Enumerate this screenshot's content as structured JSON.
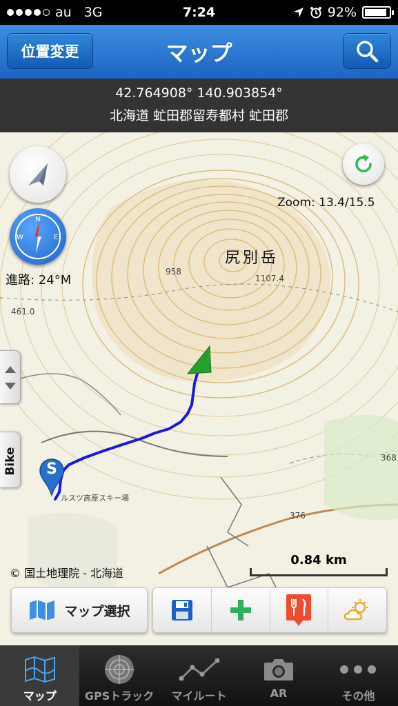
{
  "status": {
    "carrier": "au",
    "network": "3G",
    "time": "7:24",
    "battery": "92%",
    "battery_level": 0.92
  },
  "nav": {
    "left_button": "位置変更",
    "title": "マップ",
    "search_icon": "search-icon"
  },
  "info": {
    "coordinates": "42.764908° 140.903854°",
    "address": "北海道 虻田郡留寿都村 虻田郡"
  },
  "map": {
    "zoom_label": "Zoom: 13.4/15.5",
    "heading_label": "進路: 24°M",
    "side_tab_label": "Bike",
    "start_marker_label": "S",
    "attribution": "© 国土地理院 - 北海道",
    "scale_label": "0.84 km",
    "mountain_name": "尻別岳",
    "track_color": "#1a1adf",
    "arrow_color": "#27a02a"
  },
  "toolbar": {
    "map_select_label": "マップ選択",
    "icons": [
      "map-icon",
      "save-icon",
      "add-icon",
      "restaurant-icon",
      "weather-icon"
    ]
  },
  "tabs": [
    {
      "label": "マップ",
      "icon": "map-icon",
      "active": true
    },
    {
      "label": "GPSトラック",
      "icon": "radar-icon",
      "active": false
    },
    {
      "label": "マイルート",
      "icon": "route-icon",
      "active": false
    },
    {
      "label": "AR",
      "icon": "camera-icon",
      "active": false
    },
    {
      "label": "その他",
      "icon": "more-icon",
      "active": false
    }
  ]
}
